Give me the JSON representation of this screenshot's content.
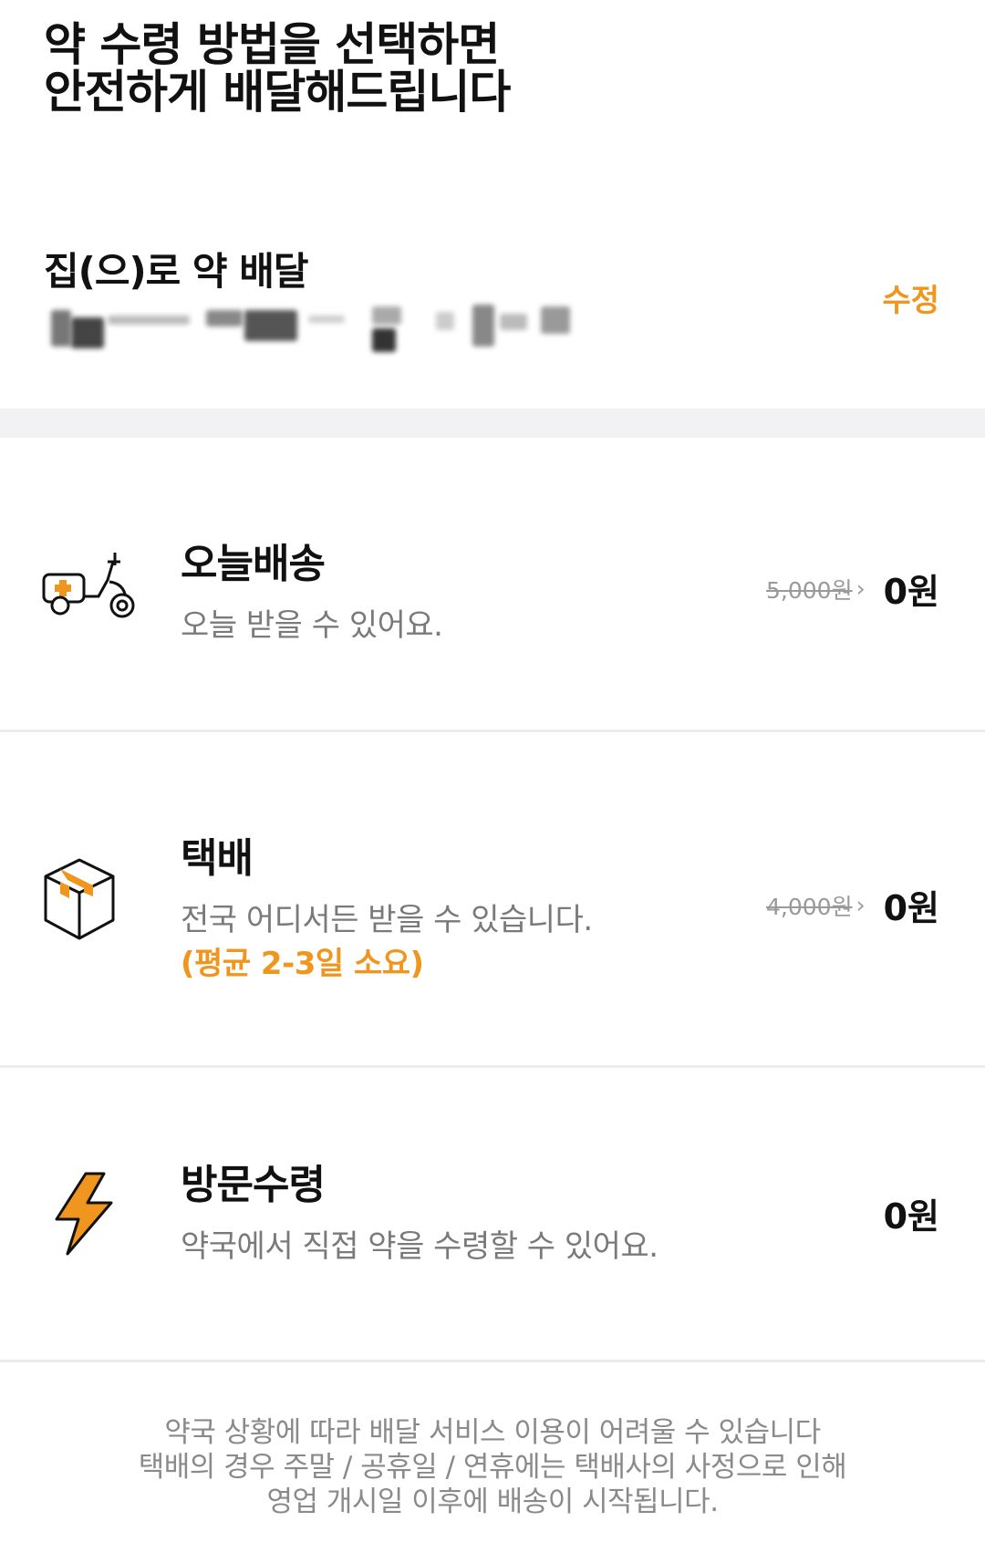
{
  "header": {
    "title_line1": "약 수령 방법을 선택하면",
    "title_line2": "안전하게 배달해드립니다"
  },
  "address": {
    "label": "집(으)로 약 배달",
    "edit_label": "수정"
  },
  "options": [
    {
      "icon": "scooter-icon",
      "title": "오늘배송",
      "description": "오늘 받을 수 있어요.",
      "original_price": "5,000원",
      "price": "0원"
    },
    {
      "icon": "box-icon",
      "title": "택배",
      "description": "전국 어디서든 받을 수 있습니다.",
      "note": "(평균 2-3일 소요)",
      "original_price": "4,000원",
      "price": "0원"
    },
    {
      "icon": "lightning-icon",
      "title": "방문수령",
      "description": "약국에서 직접 약을 수령할 수 있어요.",
      "price": "0원"
    }
  ],
  "footer": {
    "line1": "약국 상황에 따라 배달 서비스 이용이 어려울 수 있습니다",
    "line2": "택배의 경우 주말 / 공휴일 / 연휴에는 택배사의 사정으로 인해",
    "line3": "영업 개시일 이후에 배송이 시작됩니다."
  },
  "colors": {
    "accent": "#f0961e",
    "text": "#111111",
    "muted": "#7a7a7a",
    "divider": "#ececec"
  }
}
